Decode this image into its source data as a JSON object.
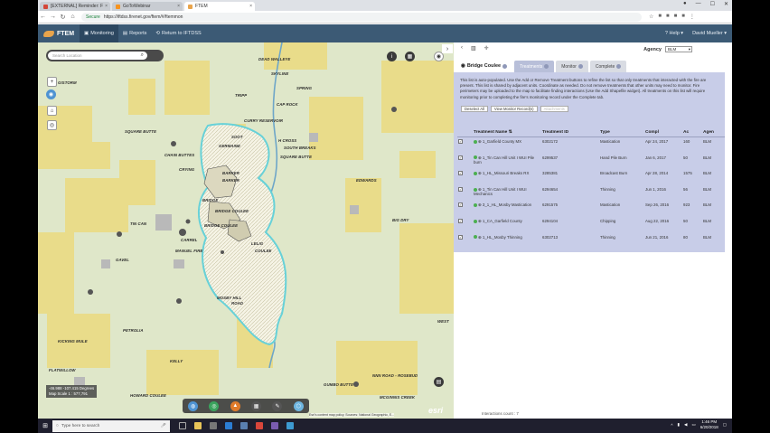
{
  "browser": {
    "tabs": [
      {
        "label": "[EXTERNAL] Reminder: F",
        "color": "#d44638"
      },
      {
        "label": "GoToWebinar",
        "color": "#f7931e"
      },
      {
        "label": "FTEM",
        "color": "#e9a44b"
      }
    ],
    "url_secure": "Secure",
    "url": "https://iftdss.firenet.gov/ftem/#/ftemmon"
  },
  "app": {
    "logo": "FTEM",
    "nav": {
      "monitoring": "Monitoring",
      "reports": "Reports",
      "return": "Return to IFTDSS"
    },
    "help": "Help",
    "user": "David Mueller"
  },
  "map": {
    "search_placeholder": "Search Location",
    "coord_line1": "-46.988 -107.415 Degrees",
    "coord_line2": "Map Scale 1 : 577,791",
    "attribution": "Esri's content map policy. Sources: National Geographic, E...",
    "esri": "esri",
    "labels": {
      "dead_walleye": "DEAD WALLEYE",
      "skyline": "SKYLINE",
      "gistorm": "GISTORM",
      "spring": "SPRING",
      "tripp": "TRIPP",
      "cap_rock": "CAP ROCK",
      "curry_reservoir": "CURRY RESERVOIR",
      "square_butte_1": "SQUARE BUTTE",
      "soot": "SOOT",
      "hcross": "H CROSS",
      "germaine": "GERMAINE",
      "south_breaks": "SOUTH BREAKS",
      "square_butte_2": "SQUARE BUTTE",
      "chain_buttes": "CHAIN BUTTES",
      "crying": "CRYING",
      "barker": "BARKER",
      "barker2": "BARKER",
      "edwards": "EDWARDS",
      "bridge": "BRIDGE",
      "bridge_coulee_1": "BRIDGE COULEE",
      "bridge_coulee_2": "BRIDGE COULEE",
      "tin_can": "TIN CAN",
      "big_dry": "BIG DRY",
      "carrel": "CARREL",
      "manuel_fire": "MANUEL FIRE",
      "lelig": "LELIG",
      "coulee": "COULEE",
      "gavel": "GAVEL",
      "mosby_hill": "MOSBY HILL",
      "road": "ROAD",
      "petrolia": "PETROLIA",
      "kicking_mule": "KICKING MULE",
      "kelly": "KELLY",
      "flatwillow": "FLATWILLOW",
      "howard_coulee": "HOWARD COULEE",
      "gumbo_butte": "GUMBO BUTTE",
      "rosebud": "ROSEBUD",
      "nnn_road": "NNN ROAD - ROSEBUD",
      "mcginnis": "MCGINNIS CREEK",
      "west": "WEST"
    }
  },
  "panel": {
    "agency_label": "Agency",
    "agency_value": "BLM",
    "fire_name": "Bridge Coulee",
    "tabs": [
      "Treatments",
      "Monitor",
      "Complete"
    ],
    "description": "This list is auto-populated. Use the Add or Remove Treatment buttons to refine the list so that only treatments that interacted with the fire are present. This list is shared by adjacent units. Coordinate as needed. Do not remove treatments that other units may need to monitor. Fire perimeters may be uploaded to the map to facilitate finding interactions (Use the Add Shapefile widget). All treatments on this list will require monitoring prior to completing the fire's monitoring record under the Complete tab.",
    "buttons": {
      "deselect": "Deselect All",
      "view": "View Monitor Record(s)",
      "attach": "Attachments"
    },
    "columns": {
      "name": "Treatment Name",
      "id": "Treatment ID",
      "type": "Type",
      "compl": "Compl",
      "ac": "Ac",
      "agency": "Agen"
    },
    "rows": [
      {
        "name": "1_Garfield County MX",
        "id": "6302172",
        "type": "Mastication",
        "compl": "Apr 24, 2017",
        "ac": "160",
        "agency": "BLM",
        "dot": "#4caf50"
      },
      {
        "name": "1_Tin Can Hill Unit I WUI Pile burn",
        "id": "6299537",
        "type": "Hand Pile Burn",
        "compl": "Jan 6, 2017",
        "ac": "50",
        "agency": "BLM",
        "dot": "#4caf50"
      },
      {
        "name": "1_HL_Missouri Breaks RX",
        "id": "3285381",
        "type": "Broadcast Burn",
        "compl": "Apr 28, 2014",
        "ac": "1575",
        "agency": "BLM",
        "dot": "#4caf50"
      },
      {
        "name": "1_Tin Can Hill Unit I WUI Mechanics",
        "id": "6294654",
        "type": "Thinning",
        "compl": "Jun 1, 2016",
        "ac": "56",
        "agency": "BLM",
        "dot": "#4caf50"
      },
      {
        "name": "3_1_HL_Mosby Mastication",
        "id": "6291575",
        "type": "Mastication",
        "compl": "Sep 26, 2016",
        "ac": "923",
        "agency": "BLM",
        "dot": "#4caf50"
      },
      {
        "name": "1_CA_Garfield County",
        "id": "6294104",
        "type": "Chipping",
        "compl": "Aug 22, 2016",
        "ac": "50",
        "agency": "BLM",
        "dot": "#4caf50"
      },
      {
        "name": "1_HL_Mosby Thinning",
        "id": "6302713",
        "type": "Thinning",
        "compl": "Jun 21, 2016",
        "ac": "80",
        "agency": "BLM",
        "dot": "#4caf50"
      }
    ],
    "count": "Interactions count : 7"
  },
  "taskbar": {
    "search": "Type here to search",
    "time": "1:46 PM",
    "date": "6/20/2018"
  }
}
